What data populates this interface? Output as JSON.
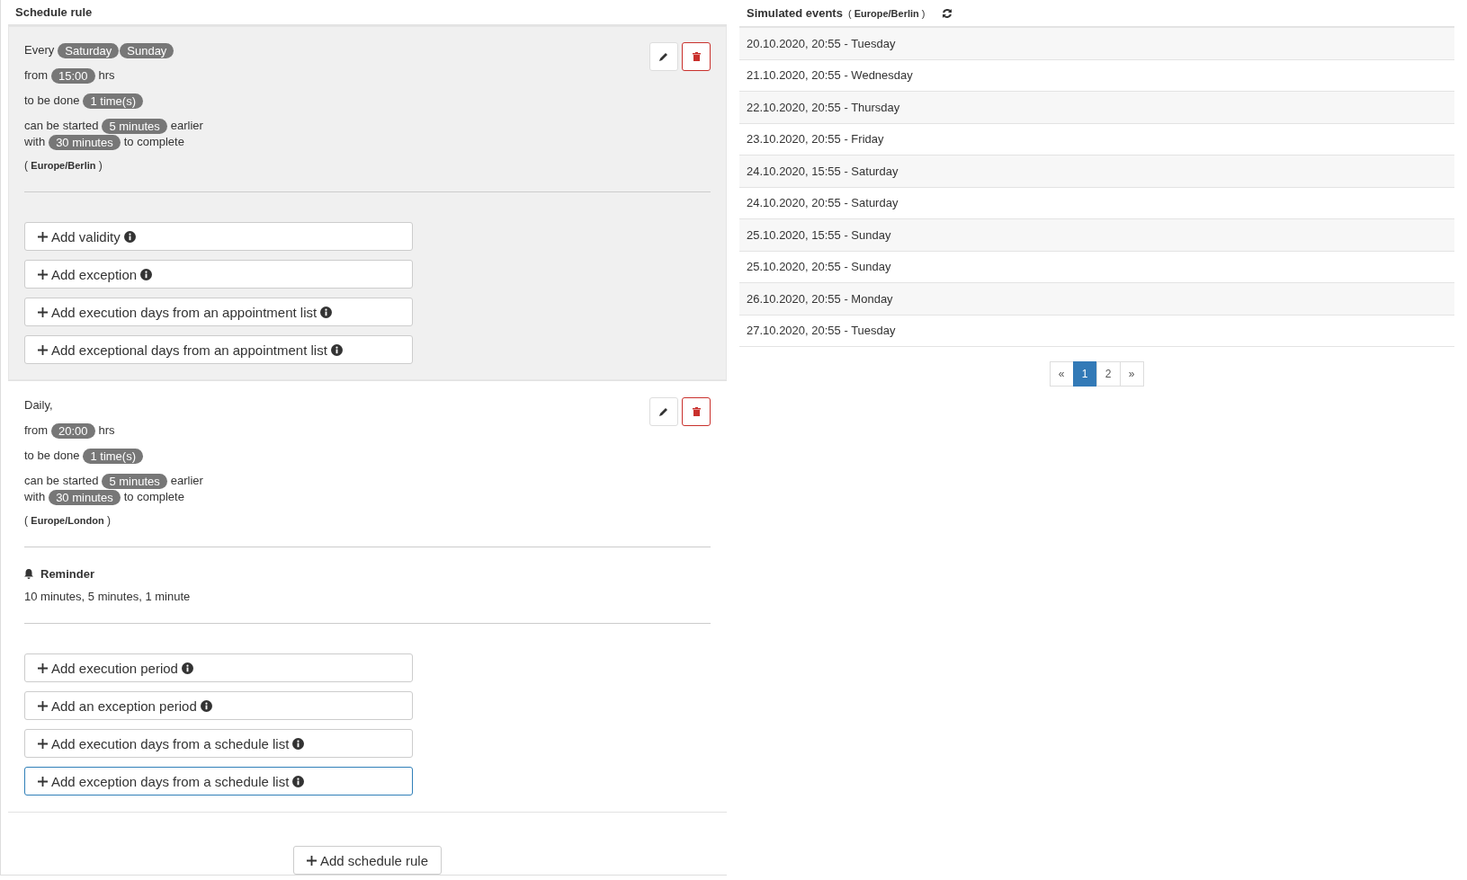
{
  "schedule_panel": {
    "title": "Schedule rule",
    "rules": [
      {
        "selected": true,
        "schedule": {
          "text": "Every",
          "badges": [
            "Saturday",
            "Sunday"
          ]
        },
        "groups": [
          [
            {
              "parts": [
                {
                  "kind": "text",
                  "text": "from"
                },
                {
                  "kind": "badge",
                  "text": "15:00"
                },
                {
                  "kind": "text",
                  "text": "hrs"
                }
              ]
            }
          ],
          [
            {
              "parts": [
                {
                  "kind": "text",
                  "text": "to be done"
                },
                {
                  "kind": "badge",
                  "text": "1 time(s)"
                }
              ]
            }
          ],
          [
            {
              "parts": [
                {
                  "kind": "text",
                  "text": "can be started"
                },
                {
                  "kind": "badge",
                  "text": "5 minutes"
                },
                {
                  "kind": "text",
                  "text": "earlier"
                }
              ]
            },
            {
              "parts": [
                {
                  "kind": "text",
                  "text": "with"
                },
                {
                  "kind": "badge",
                  "text": "30 minutes"
                },
                {
                  "kind": "text",
                  "text": "to complete"
                }
              ]
            }
          ]
        ],
        "timezone": "( **Europe/Berlin** )",
        "actions": [
          {
            "label": "Add validity",
            "focused": false
          },
          {
            "label": "Add exception",
            "focused": false
          },
          {
            "label": "Add execution days from an appointment list",
            "focused": false
          },
          {
            "label": "Add exceptional days from an appointment list",
            "focused": false
          }
        ]
      },
      {
        "selected": false,
        "schedule": {
          "text": "Daily,"
        },
        "groups": [
          [
            {
              "parts": [
                {
                  "kind": "text",
                  "text": "from"
                },
                {
                  "kind": "badge",
                  "text": "20:00"
                },
                {
                  "kind": "text",
                  "text": "hrs"
                }
              ]
            }
          ],
          [
            {
              "parts": [
                {
                  "kind": "text",
                  "text": "to be done"
                },
                {
                  "kind": "badge",
                  "text": "1 time(s)"
                }
              ]
            }
          ],
          [
            {
              "parts": [
                {
                  "kind": "text",
                  "text": "can be started"
                },
                {
                  "kind": "badge",
                  "text": "5 minutes"
                },
                {
                  "kind": "text",
                  "text": "earlier"
                }
              ]
            },
            {
              "parts": [
                {
                  "kind": "text",
                  "text": "with"
                },
                {
                  "kind": "badge",
                  "text": "30 minutes"
                },
                {
                  "kind": "text",
                  "text": "to complete"
                }
              ]
            }
          ]
        ],
        "timezone": "( **Europe/London** )",
        "reminder": {
          "title": "Reminder",
          "text": "10 minutes, 5 minutes, 1 minute"
        },
        "actions": [
          {
            "label": "Add execution period",
            "focused": false
          },
          {
            "label": "Add an exception period",
            "focused": false
          },
          {
            "label": "Add execution days from a schedule list",
            "focused": false
          },
          {
            "label": "Add exception days from a schedule list",
            "focused": true
          }
        ]
      }
    ],
    "add_button": "Add schedule rule"
  },
  "events_panel": {
    "title": "Simulated events",
    "timezone": "( **Europe/Berlin** )",
    "events": [
      "20.10.2020, 20:55 - Tuesday",
      "21.10.2020, 20:55 - Wednesday",
      "22.10.2020, 20:55 - Thursday",
      "23.10.2020, 20:55 - Friday",
      "24.10.2020, 15:55 - Saturday",
      "24.10.2020, 20:55 - Saturday",
      "25.10.2020, 15:55 - Sunday",
      "25.10.2020, 20:55 - Sunday",
      "26.10.2020, 20:55 - Monday",
      "27.10.2020, 20:55 - Tuesday"
    ],
    "pagination": [
      {
        "label": "«",
        "selected": false
      },
      {
        "label": "1",
        "selected": true
      },
      {
        "label": "2",
        "selected": false
      },
      {
        "label": "»",
        "selected": false
      }
    ]
  }
}
